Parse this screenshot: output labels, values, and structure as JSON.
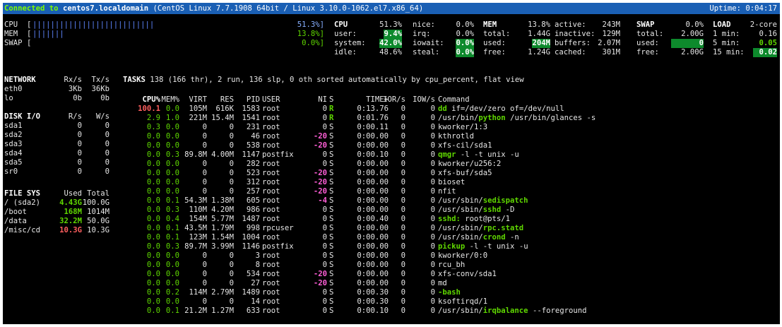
{
  "titlebar": {
    "connected_prefix": "Connected to",
    "host": "centos7.localdomain",
    "os_info": "(CentOS Linux 7.7.1908 64bit / Linux 3.10.0-1062.el7.x86_64)",
    "uptime": "Uptime: 0:04:17"
  },
  "bars": [
    {
      "label": "CPU",
      "value": "51.3%]",
      "fill": 0.513
    },
    {
      "label": "MEM",
      "value": "13.8%]",
      "fill": 0.138
    },
    {
      "label": "SWAP",
      "value": "0.0%]",
      "fill": 0.0
    }
  ],
  "cpu": {
    "title": "CPU",
    "total": "51.3%",
    "user_label": "user:",
    "user": "9.4%",
    "system_label": "system:",
    "system": "42.0%",
    "idle_label": "idle:",
    "idle": "48.6%",
    "nice_label": "nice:",
    "nice": "0.0%",
    "irq_label": "irq:",
    "irq": "0.0%",
    "iowait_label": "iowait:",
    "iowait": "0.0%",
    "steal_label": "steal:",
    "steal": "0.0%"
  },
  "mem": {
    "title": "MEM",
    "percent": "13.8%",
    "total_label": "total:",
    "total": "1.44G",
    "used_label": "used:",
    "used": "204M",
    "free_label": "free:",
    "free": "1.24G",
    "active_label": "active:",
    "active": "243M",
    "inactive_label": "inactive:",
    "inactive": "129M",
    "buffers_label": "buffers:",
    "buffers": "2.07M",
    "cached_label": "cached:",
    "cached": "301M"
  },
  "swap": {
    "title": "SWAP",
    "percent": "0.0%",
    "total_label": "total:",
    "total": "2.00G",
    "used_label": "used:",
    "used": "0",
    "free_label": "free:",
    "free": "2.00G"
  },
  "load": {
    "title": "LOAD",
    "cores": "2-core",
    "m1_label": "1 min:",
    "m1": "0.16",
    "m5_label": "5 min:",
    "m5": "0.05",
    "m15_label": "15 min:",
    "m15": "0.02"
  },
  "network": {
    "headers": [
      "NETWORK",
      "Rx/s",
      "Tx/s"
    ],
    "rows": [
      [
        "eth0",
        "3Kb",
        "36Kb"
      ],
      [
        "lo",
        "0b",
        "0b"
      ]
    ]
  },
  "diskio": {
    "headers": [
      "DISK I/O",
      "R/s",
      "W/s"
    ],
    "rows": [
      [
        "sda1",
        "0",
        "0"
      ],
      [
        "sda2",
        "0",
        "0"
      ],
      [
        "sda3",
        "0",
        "0"
      ],
      [
        "sda4",
        "0",
        "0"
      ],
      [
        "sda5",
        "0",
        "0"
      ],
      [
        "sr0",
        "0",
        "0"
      ]
    ]
  },
  "filesys": {
    "headers": [
      "FILE SYS",
      "Used",
      "Total"
    ],
    "rows": [
      [
        "/ (sda2)",
        "4.43G",
        "100.0G",
        "g"
      ],
      [
        "/boot",
        "168M",
        "1014M",
        "g"
      ],
      [
        "/data",
        "32.2M",
        "50.0G",
        "g"
      ],
      [
        "/misc/cd",
        "10.3G",
        "10.3G",
        "red"
      ]
    ]
  },
  "tasks": {
    "label": "TASKS",
    "summary": "138 (166 thr), 2 run, 136 slp, 0 oth sorted automatically by cpu_percent, flat view"
  },
  "proc_headers": [
    "CPU%",
    "MEM%",
    "VIRT",
    "RES",
    "PID",
    "USER",
    "NI",
    "S",
    "TIME+",
    "IOR/s",
    "IOW/s",
    "Command"
  ],
  "processes": [
    {
      "cpu": "100.1",
      "mem": "0.0",
      "virt": "105M",
      "res": "616K",
      "pid": "1583",
      "user": "root",
      "ni": "0",
      "s": "R",
      "time": "0:13.76",
      "ior": "0",
      "iow": "0",
      "cmd": "dd",
      "args": " if=/dev/zero of=/dev/null",
      "cmdpre": ""
    },
    {
      "cpu": "2.9",
      "mem": "1.0",
      "virt": "221M",
      "res": "15.4M",
      "pid": "1541",
      "user": "root",
      "ni": "0",
      "s": "R",
      "time": "0:01.76",
      "ior": "0",
      "iow": "0",
      "cmd": "python",
      "args": " /usr/bin/glances -s",
      "cmdpre": "/usr/bin/"
    },
    {
      "cpu": "0.3",
      "mem": "0.0",
      "virt": "0",
      "res": "0",
      "pid": "231",
      "user": "root",
      "ni": "0",
      "s": "S",
      "time": "0:00.11",
      "ior": "0",
      "iow": "0",
      "cmd": "",
      "args": "kworker/1:3",
      "cmdpre": ""
    },
    {
      "cpu": "0.0",
      "mem": "0.0",
      "virt": "0",
      "res": "0",
      "pid": "46",
      "user": "root",
      "ni": "-20",
      "s": "S",
      "time": "0:00.00",
      "ior": "0",
      "iow": "0",
      "cmd": "",
      "args": "kthrotld",
      "cmdpre": ""
    },
    {
      "cpu": "0.0",
      "mem": "0.0",
      "virt": "0",
      "res": "0",
      "pid": "538",
      "user": "root",
      "ni": "-20",
      "s": "S",
      "time": "0:00.00",
      "ior": "0",
      "iow": "0",
      "cmd": "",
      "args": "xfs-cil/sda1",
      "cmdpre": ""
    },
    {
      "cpu": "0.0",
      "mem": "0.3",
      "virt": "89.8M",
      "res": "4.00M",
      "pid": "1147",
      "user": "postfix",
      "ni": "0",
      "s": "S",
      "time": "0:00.10",
      "ior": "0",
      "iow": "0",
      "cmd": "qmgr",
      "args": " -l -t unix -u",
      "cmdpre": ""
    },
    {
      "cpu": "0.0",
      "mem": "0.0",
      "virt": "0",
      "res": "0",
      "pid": "282",
      "user": "root",
      "ni": "0",
      "s": "S",
      "time": "0:00.00",
      "ior": "0",
      "iow": "0",
      "cmd": "",
      "args": "kworker/u256:2",
      "cmdpre": ""
    },
    {
      "cpu": "0.0",
      "mem": "0.0",
      "virt": "0",
      "res": "0",
      "pid": "523",
      "user": "root",
      "ni": "-20",
      "s": "S",
      "time": "0:00.00",
      "ior": "0",
      "iow": "0",
      "cmd": "",
      "args": "xfs-buf/sda5",
      "cmdpre": ""
    },
    {
      "cpu": "0.0",
      "mem": "0.0",
      "virt": "0",
      "res": "0",
      "pid": "312",
      "user": "root",
      "ni": "-20",
      "s": "S",
      "time": "0:00.00",
      "ior": "0",
      "iow": "0",
      "cmd": "",
      "args": "bioset",
      "cmdpre": ""
    },
    {
      "cpu": "0.0",
      "mem": "0.0",
      "virt": "0",
      "res": "0",
      "pid": "257",
      "user": "root",
      "ni": "-20",
      "s": "S",
      "time": "0:00.00",
      "ior": "0",
      "iow": "0",
      "cmd": "",
      "args": "nfit",
      "cmdpre": ""
    },
    {
      "cpu": "0.0",
      "mem": "0.1",
      "virt": "54.3M",
      "res": "1.38M",
      "pid": "605",
      "user": "root",
      "ni": "-4",
      "s": "S",
      "time": "0:00.00",
      "ior": "0",
      "iow": "0",
      "cmd": "sedispatch",
      "args": "",
      "cmdpre": "/usr/sbin/"
    },
    {
      "cpu": "0.0",
      "mem": "0.3",
      "virt": "110M",
      "res": "4.20M",
      "pid": "986",
      "user": "root",
      "ni": "0",
      "s": "S",
      "time": "0:00.00",
      "ior": "0",
      "iow": "0",
      "cmd": "sshd",
      "args": " -D",
      "cmdpre": "/usr/sbin/"
    },
    {
      "cpu": "0.0",
      "mem": "0.4",
      "virt": "154M",
      "res": "5.77M",
      "pid": "1487",
      "user": "root",
      "ni": "0",
      "s": "S",
      "time": "0:00.40",
      "ior": "0",
      "iow": "0",
      "cmd": "sshd:",
      "args": " root@pts/1",
      "cmdpre": ""
    },
    {
      "cpu": "0.0",
      "mem": "0.1",
      "virt": "43.5M",
      "res": "1.79M",
      "pid": "998",
      "user": "rpcuser",
      "ni": "0",
      "s": "S",
      "time": "0:00.00",
      "ior": "0",
      "iow": "0",
      "cmd": "rpc.statd",
      "args": "",
      "cmdpre": "/usr/sbin/"
    },
    {
      "cpu": "0.0",
      "mem": "0.1",
      "virt": "123M",
      "res": "1.54M",
      "pid": "1004",
      "user": "root",
      "ni": "0",
      "s": "S",
      "time": "0:00.00",
      "ior": "0",
      "iow": "0",
      "cmd": "crond",
      "args": " -n",
      "cmdpre": "/usr/sbin/"
    },
    {
      "cpu": "0.0",
      "mem": "0.3",
      "virt": "89.7M",
      "res": "3.99M",
      "pid": "1146",
      "user": "postfix",
      "ni": "0",
      "s": "S",
      "time": "0:00.00",
      "ior": "0",
      "iow": "0",
      "cmd": "pickup",
      "args": " -l -t unix -u",
      "cmdpre": ""
    },
    {
      "cpu": "0.0",
      "mem": "0.0",
      "virt": "0",
      "res": "0",
      "pid": "3",
      "user": "root",
      "ni": "0",
      "s": "S",
      "time": "0:00.00",
      "ior": "0",
      "iow": "0",
      "cmd": "",
      "args": "kworker/0:0",
      "cmdpre": ""
    },
    {
      "cpu": "0.0",
      "mem": "0.0",
      "virt": "0",
      "res": "0",
      "pid": "8",
      "user": "root",
      "ni": "0",
      "s": "S",
      "time": "0:00.00",
      "ior": "0",
      "iow": "0",
      "cmd": "",
      "args": "rcu_bh",
      "cmdpre": ""
    },
    {
      "cpu": "0.0",
      "mem": "0.0",
      "virt": "0",
      "res": "0",
      "pid": "534",
      "user": "root",
      "ni": "-20",
      "s": "S",
      "time": "0:00.00",
      "ior": "0",
      "iow": "0",
      "cmd": "",
      "args": "xfs-conv/sda1",
      "cmdpre": ""
    },
    {
      "cpu": "0.0",
      "mem": "0.0",
      "virt": "0",
      "res": "0",
      "pid": "27",
      "user": "root",
      "ni": "-20",
      "s": "S",
      "time": "0:00.00",
      "ior": "0",
      "iow": "0",
      "cmd": "",
      "args": "md",
      "cmdpre": ""
    },
    {
      "cpu": "0.0",
      "mem": "0.2",
      "virt": "114M",
      "res": "2.79M",
      "pid": "1489",
      "user": "root",
      "ni": "0",
      "s": "S",
      "time": "0:00.30",
      "ior": "0",
      "iow": "0",
      "cmd": "-bash",
      "args": "",
      "cmdpre": ""
    },
    {
      "cpu": "0.0",
      "mem": "0.0",
      "virt": "0",
      "res": "0",
      "pid": "14",
      "user": "root",
      "ni": "0",
      "s": "S",
      "time": "0:00.30",
      "ior": "0",
      "iow": "0",
      "cmd": "",
      "args": "ksoftirqd/1",
      "cmdpre": ""
    },
    {
      "cpu": "0.0",
      "mem": "0.1",
      "virt": "21.2M",
      "res": "1.27M",
      "pid": "633",
      "user": "root",
      "ni": "0",
      "s": "S",
      "time": "0:00.10",
      "ior": "0",
      "iow": "0",
      "cmd": "irqbalance",
      "args": " --foreground",
      "cmdpre": "/usr/sbin/"
    }
  ]
}
